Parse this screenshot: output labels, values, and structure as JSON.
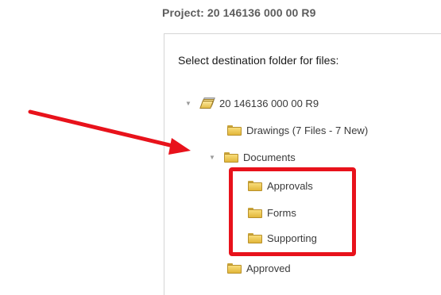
{
  "header": {
    "project_title": "Project: 20 146136 000 00 R9"
  },
  "dialog": {
    "instruction": "Select destination folder for files:"
  },
  "tree": {
    "root": {
      "label": "20 146136 000 00 R9",
      "expanded": true,
      "icon": "project-folder-icon"
    },
    "drawings": {
      "label": "Drawings (7 Files - 7 New)",
      "icon": "folder-icon"
    },
    "documents": {
      "label": "Documents",
      "expanded": true,
      "icon": "folder-icon"
    },
    "approvals": {
      "label": "Approvals",
      "icon": "folder-icon"
    },
    "forms": {
      "label": "Forms",
      "icon": "folder-icon"
    },
    "supporting": {
      "label": "Supporting",
      "icon": "folder-icon"
    },
    "approved": {
      "label": "Approved",
      "icon": "folder-icon"
    }
  },
  "annotations": {
    "arrow_color": "#e8121b",
    "highlight_color": "#e8121b"
  }
}
